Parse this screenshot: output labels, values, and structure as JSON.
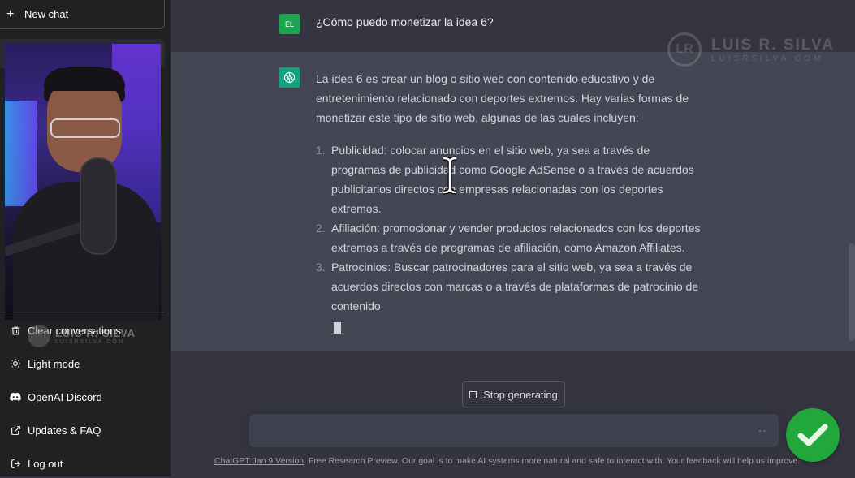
{
  "sidebar": {
    "new_chat_label": "New chat",
    "items": [
      {
        "label": "Clear conversations",
        "icon": "trash-icon"
      },
      {
        "label": "Light mode",
        "icon": "sun-icon"
      },
      {
        "label": "OpenAI Discord",
        "icon": "discord-icon"
      },
      {
        "label": "Updates & FAQ",
        "icon": "external-link-icon"
      },
      {
        "label": "Log out",
        "icon": "logout-icon"
      }
    ],
    "watermark": {
      "name": "LUIS R. SILVA",
      "sub": "LUISRSILVA.COM"
    }
  },
  "conversation": {
    "user": {
      "initials": "EL",
      "text": "¿Cómo puedo monetizar la idea 6?"
    },
    "assistant": {
      "intro": "La idea 6 es crear un blog o sitio web con contenido educativo y de entretenimiento relacionado con deportes extremos. Hay varias formas de monetizar este tipo de sitio web, algunas de las cuales incluyen:",
      "list": [
        {
          "num": "1.",
          "text": "Publicidad: colocar anuncios en el sitio web, ya sea a través de programas de publicidad como Google AdSense o a través de acuerdos publicitarios directos con empresas relacionadas con los deportes extremos."
        },
        {
          "num": "2.",
          "text": "Afiliación: promocionar y vender productos relacionados con los deportes extremos a través de programas de afiliación, como Amazon Affiliates."
        },
        {
          "num": "3.",
          "text": "Patrocinios: Buscar patrocinadores para el sitio web, ya sea a través de acuerdos directos con marcas o a través de plataformas de patrocinio de contenido"
        }
      ]
    }
  },
  "watermark": {
    "name": "LUIS R. SILVA",
    "sub": "LUISRSILVA.COM",
    "logo": "LR"
  },
  "controls": {
    "stop_label": "Stop generating",
    "input_placeholder": "",
    "input_dots": "··"
  },
  "footer": {
    "link": "ChatGPT Jan 9 Version",
    "text": ". Free Research Preview. Our goal is to make AI systems more natural and safe to interact with. Your feedback will help us improve."
  },
  "colors": {
    "sidebar_bg": "#202123",
    "main_bg": "#343541",
    "assistant_bg": "#444654",
    "user_avatar": "#1aa54f",
    "gpt_avatar": "#10a37f",
    "check_badge": "#22a83a"
  }
}
